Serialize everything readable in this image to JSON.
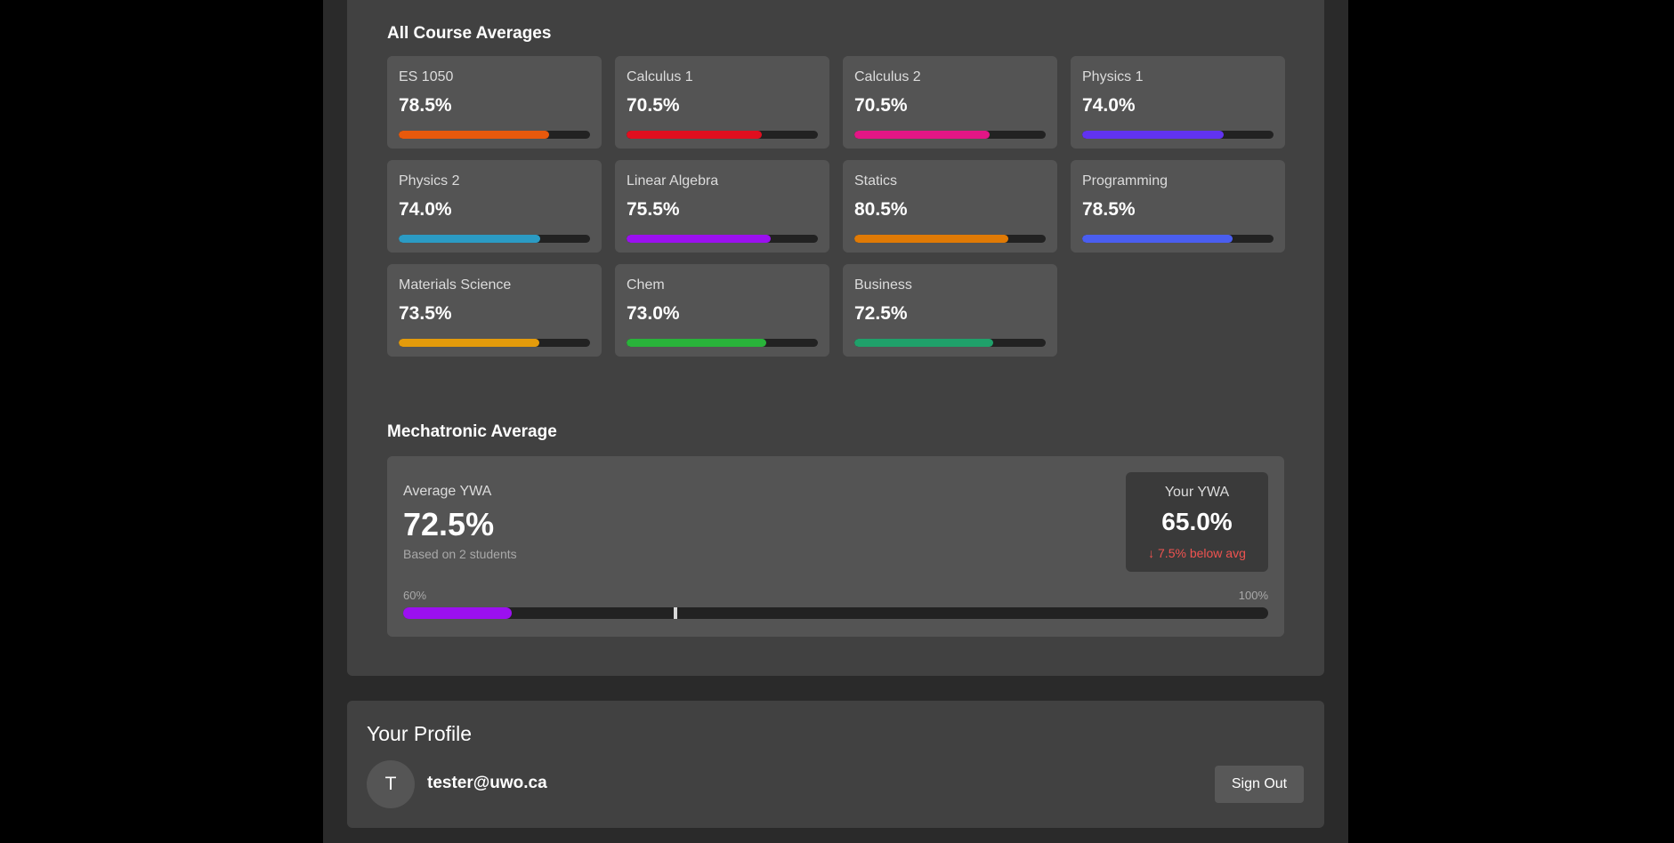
{
  "averages": {
    "title": "All Course Averages",
    "courses": [
      {
        "name": "ES 1050",
        "value": "78.5%",
        "level": 78.5,
        "color": "#e8590c"
      },
      {
        "name": "Calculus 1",
        "value": "70.5%",
        "level": 70.5,
        "color": "#e10e1f"
      },
      {
        "name": "Calculus 2",
        "value": "70.5%",
        "level": 70.5,
        "color": "#e21685"
      },
      {
        "name": "Physics 1",
        "value": "74.0%",
        "level": 74.0,
        "color": "#6133f0"
      },
      {
        "name": "Physics 2",
        "value": "74.0%",
        "level": 74.0,
        "color": "#2b9bc4"
      },
      {
        "name": "Linear Algebra",
        "value": "75.5%",
        "level": 75.5,
        "color": "#9b10f0"
      },
      {
        "name": "Statics",
        "value": "80.5%",
        "level": 80.5,
        "color": "#e07a05"
      },
      {
        "name": "Programming",
        "value": "78.5%",
        "level": 78.5,
        "color": "#4a5ef0"
      },
      {
        "name": "Materials Science",
        "value": "73.5%",
        "level": 73.5,
        "color": "#e39b0b"
      },
      {
        "name": "Chem",
        "value": "73.0%",
        "level": 73.0,
        "color": "#29b33a"
      },
      {
        "name": "Business",
        "value": "72.5%",
        "level": 72.5,
        "color": "#1fa06a"
      }
    ]
  },
  "mechatronic": {
    "title": "Mechatronic Average",
    "average_label": "Average YWA",
    "average_value": "72.5%",
    "based_on": "Based on 2 students",
    "your_label": "Your YWA",
    "your_value": "65.0%",
    "delta": "↓ 7.5% below avg",
    "delta_color": "#ef5350",
    "scale_min": "60%",
    "scale_max": "100%",
    "scale_low": 60,
    "scale_high": 100,
    "fill_color": "#9b10f0",
    "your_level": 65.0,
    "average_level": 72.5
  },
  "profile": {
    "title": "Your Profile",
    "avatar_initial": "T",
    "email": "tester@uwo.ca",
    "sign_out_label": "Sign Out"
  }
}
